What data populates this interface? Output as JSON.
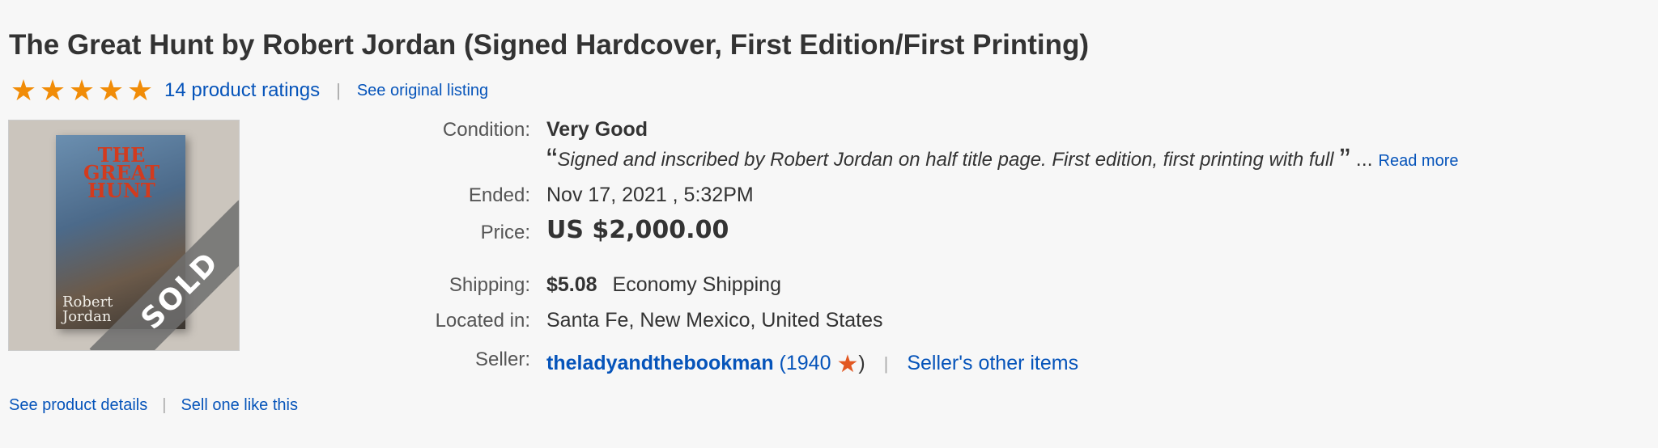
{
  "listing": {
    "title": "The Great Hunt by Robert Jordan (Signed Hardcover, First Edition/First Printing)",
    "rating_stars": 5,
    "ratings_count_label": "14 product ratings",
    "see_original_label": "See original listing",
    "image": {
      "book_title": "THE GREAT HUNT",
      "book_author": "Robert Jordan",
      "badge": "SOLD"
    }
  },
  "details": {
    "condition": {
      "label": "Condition:",
      "value": "Very Good"
    },
    "description": {
      "open_quote": "“",
      "text": "Signed and inscribed by Robert Jordan on half title page. First edition, first printing with full",
      "close_quote": "”",
      "ellipsis": "...",
      "read_more": "Read more"
    },
    "ended": {
      "label": "Ended:",
      "value": "Nov 17, 2021 , 5:32PM"
    },
    "price": {
      "label": "Price:",
      "value": "US $2,000.00"
    },
    "shipping": {
      "label": "Shipping:",
      "cost": "$5.08",
      "method": "Economy Shipping"
    },
    "located": {
      "label": "Located in:",
      "value": "Santa Fe, New Mexico, United States"
    },
    "seller": {
      "label": "Seller:",
      "name": "theladyandthebookman",
      "feedback_open": "(1940",
      "feedback_close": ")",
      "other_items": "Seller's other items"
    }
  },
  "footer": {
    "product_details": "See product details",
    "sell_one": "Sell one like this"
  },
  "colors": {
    "link": "#0654ba",
    "star": "#f18c07",
    "seller_star": "#e25822"
  }
}
